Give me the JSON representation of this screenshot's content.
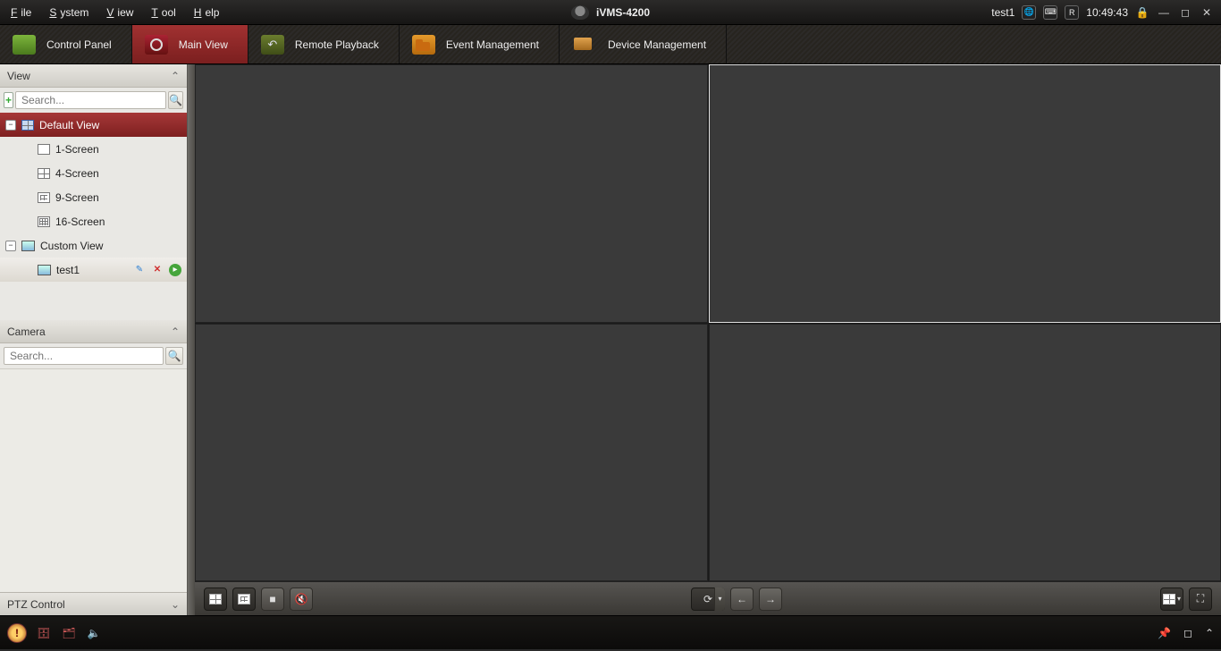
{
  "menu": {
    "file": "File",
    "system": "System",
    "view": "View",
    "tool": "Tool",
    "help": "Help"
  },
  "app_title": "iVMS-4200",
  "user": "test1",
  "clock": "10:49:43",
  "tabs": {
    "control_panel": "Control Panel",
    "main_view": "Main View",
    "remote_playback": "Remote Playback",
    "event_management": "Event Management",
    "device_management": "Device Management"
  },
  "panels": {
    "view_title": "View",
    "camera_title": "Camera",
    "ptz_title": "PTZ Control",
    "search_placeholder": "Search..."
  },
  "tree": {
    "default_view": "Default View",
    "screen1": "1-Screen",
    "screen4": "4-Screen",
    "screen9": "9-Screen",
    "screen16": "16-Screen",
    "custom_view": "Custom View",
    "custom_item": "test1"
  }
}
